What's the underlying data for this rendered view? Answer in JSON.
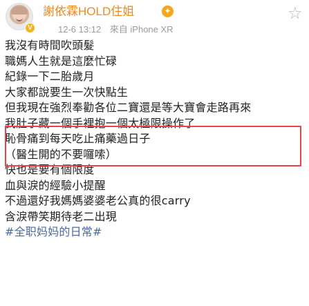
{
  "header": {
    "username": "謝依霖HOLD住姐",
    "vip_badge": "V",
    "verified_icon": "medal",
    "timestamp": "12-6 13:12",
    "source": "來自 iPhone XR",
    "follow_icon": "star-icon"
  },
  "post": {
    "lines": [
      "我沒有時間吹頭髮",
      "職媽人生就是這麼忙碌",
      "紀錄一下二胎歲月",
      "大家都說要生一次快點生",
      "但我現在強烈奉勸各位二寶還是等大寶會走路再來",
      "我肚子藏一個手裡抱一個太極限操作了",
      "恥骨痛到每天吃止痛藥過日子",
      "（醫生開的不要囉嗦）",
      "快也是要有個限度",
      "血與淚的經驗小提醒",
      "不過還好我媽媽婆婆老公真的很carry",
      "含淚帶笑期待老二出現",
      "#全职妈妈的日常#"
    ]
  },
  "colors": {
    "username": "#f08a1c",
    "highlight_border": "#e74646",
    "hashtag": "#4a6aa1"
  }
}
